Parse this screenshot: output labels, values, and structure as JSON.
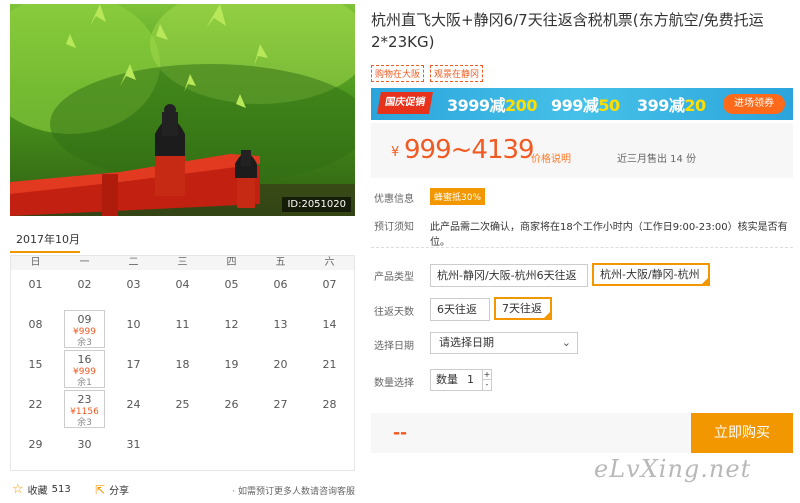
{
  "hero": {
    "id_label": "ID:2051020"
  },
  "calendar": {
    "month_label": "2017年10月",
    "weekdays": [
      "日",
      "一",
      "二",
      "三",
      "四",
      "五",
      "六"
    ],
    "days": [
      {
        "n": "01"
      },
      {
        "n": "02"
      },
      {
        "n": "03"
      },
      {
        "n": "04"
      },
      {
        "n": "05"
      },
      {
        "n": "06"
      },
      {
        "n": "07"
      },
      {
        "n": "08"
      },
      {
        "n": "09",
        "price": "¥999",
        "remain": "余3"
      },
      {
        "n": "10"
      },
      {
        "n": "11"
      },
      {
        "n": "12"
      },
      {
        "n": "13"
      },
      {
        "n": "14"
      },
      {
        "n": "15"
      },
      {
        "n": "16",
        "price": "¥999",
        "remain": "余1"
      },
      {
        "n": "17"
      },
      {
        "n": "18"
      },
      {
        "n": "19"
      },
      {
        "n": "20"
      },
      {
        "n": "21"
      },
      {
        "n": "22"
      },
      {
        "n": "23",
        "price": "¥1156",
        "remain": "余3"
      },
      {
        "n": "24"
      },
      {
        "n": "25"
      },
      {
        "n": "26"
      },
      {
        "n": "27"
      },
      {
        "n": "28"
      },
      {
        "n": "29"
      },
      {
        "n": "30"
      },
      {
        "n": "31"
      }
    ]
  },
  "actions": {
    "favorite_label": "收藏",
    "favorite_count": "513",
    "share_label": "分享",
    "note": "· 如需预订更多人数请咨询客服"
  },
  "product": {
    "title": "杭州直飞大阪+静冈6/7天往返含税机票(东方航空/免费托运2*23KG)",
    "tags": [
      "购物在大阪",
      "观景在静冈"
    ]
  },
  "banner": {
    "badge": "国庆促销",
    "deals": [
      {
        "base": "3999减",
        "off": "200"
      },
      {
        "base": "999减",
        "off": "50"
      },
      {
        "base": "399减",
        "off": "20"
      }
    ],
    "button": "进场领券"
  },
  "price": {
    "currency": "¥",
    "range": "999~4139",
    "explain_link": "价格说明",
    "sold": "近三月售出 14 份"
  },
  "info": {
    "promo_label": "优惠信息",
    "promo_tag": "蜂蜜抵30%",
    "notice_label": "预订须知",
    "notice_text": "此产品需二次确认，商家将在18个工作小时内（工作日9:00-23:00）核实是否有位。"
  },
  "options": {
    "type_label": "产品类型",
    "types": [
      "杭州-静冈/大阪-杭州6天往返",
      "杭州-大阪/静冈-杭州"
    ],
    "days_label": "往返天数",
    "days": [
      "6天往返",
      "7天往返"
    ],
    "date_label": "选择日期",
    "date_placeholder": "请选择日期",
    "qty_label": "数量选择",
    "qty_text": "数量",
    "qty_value": "1"
  },
  "buy": {
    "total": "--",
    "button": "立即购买"
  },
  "watermark": "eLvXing.net",
  "colors": {
    "accent": "#f39700",
    "price": "#f15a22",
    "banner": "#2ba4dc"
  }
}
